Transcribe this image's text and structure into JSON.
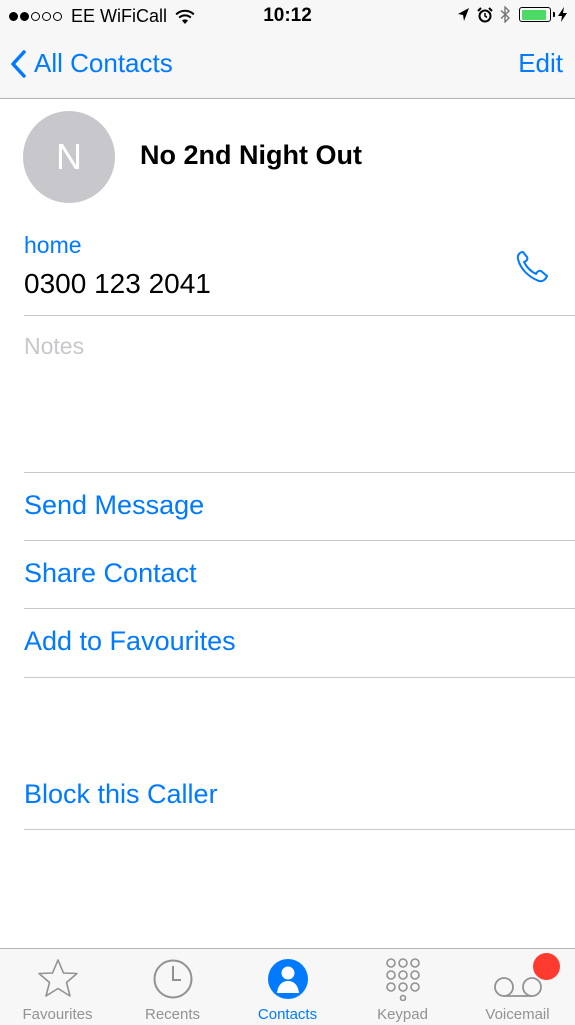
{
  "status_bar": {
    "signal_filled": 2,
    "signal_total": 5,
    "carrier": "EE WiFiCall",
    "time": "10:12",
    "battery_percent": 90,
    "icons": [
      "location-arrow-icon",
      "alarm-icon",
      "bluetooth-icon",
      "battery-icon",
      "charging-bolt-icon"
    ],
    "battery_color": "#4cd964"
  },
  "nav": {
    "back_label": "All Contacts",
    "edit_label": "Edit"
  },
  "contact": {
    "initial": "N",
    "name": "No 2nd Night Out",
    "phone_label": "home",
    "phone_number": "0300 123 2041",
    "notes_placeholder": "Notes"
  },
  "actions": {
    "send_message": "Send Message",
    "share_contact": "Share Contact",
    "add_favourites": "Add to Favourites",
    "block_caller": "Block this Caller"
  },
  "tabs": [
    {
      "label": "Favourites",
      "icon": "star-icon",
      "active": false
    },
    {
      "label": "Recents",
      "icon": "clock-icon",
      "active": false
    },
    {
      "label": "Contacts",
      "icon": "person-icon",
      "active": true
    },
    {
      "label": "Keypad",
      "icon": "keypad-icon",
      "active": false
    },
    {
      "label": "Voicemail",
      "icon": "voicemail-icon",
      "active": false
    }
  ],
  "colors": {
    "accent": "#007aff",
    "avatar": "#c7c7cc",
    "badge": "#ff3b30",
    "inactive": "#929292"
  }
}
